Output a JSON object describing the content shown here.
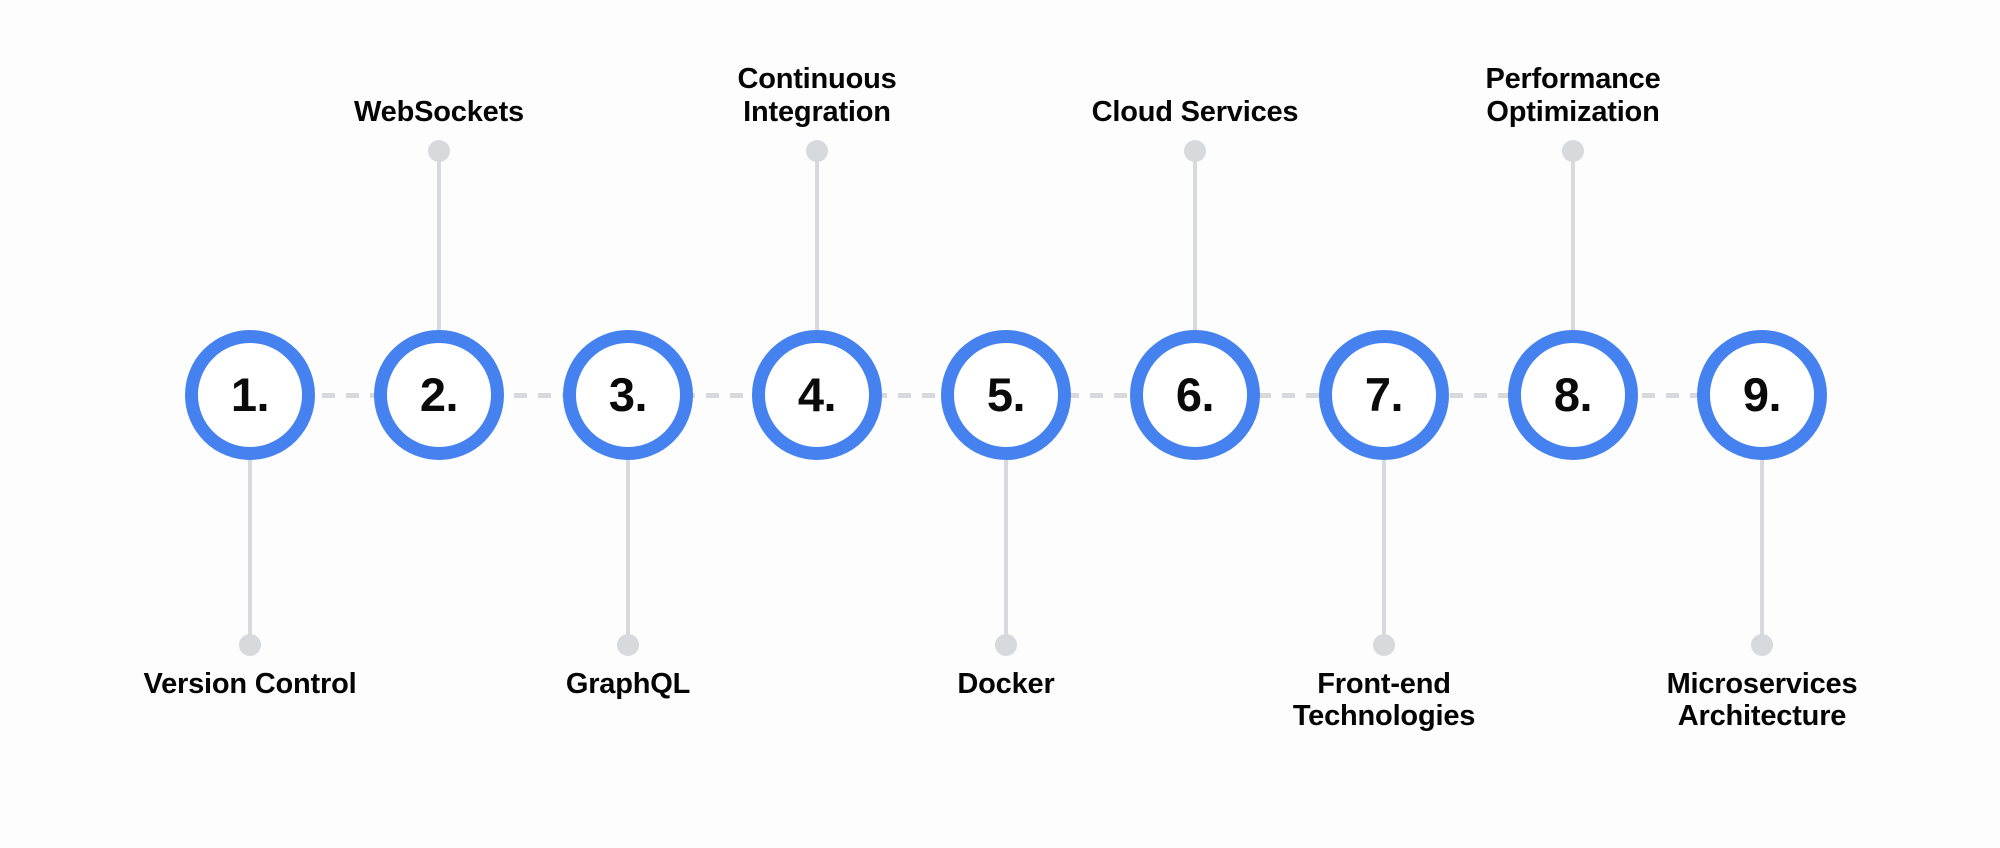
{
  "diagram": {
    "type": "horizontal-numbered-timeline",
    "orientation": "horizontal",
    "step_count": 9,
    "colors": {
      "accent": "#4582f0",
      "connector": "#d7d9dd",
      "text": "#050505",
      "background": "#fdfdfd",
      "circle_fill": "#ffffff"
    },
    "steps": [
      {
        "number": "1.",
        "label": "Version Control",
        "side": "below"
      },
      {
        "number": "2.",
        "label": "WebSockets",
        "side": "above"
      },
      {
        "number": "3.",
        "label": "GraphQL",
        "side": "below"
      },
      {
        "number": "4.",
        "label": "Continuous\nIntegration",
        "side": "above"
      },
      {
        "number": "5.",
        "label": "Docker",
        "side": "below"
      },
      {
        "number": "6.",
        "label": "Cloud Services",
        "side": "above"
      },
      {
        "number": "7.",
        "label": "Front-end\nTechnologies",
        "side": "below"
      },
      {
        "number": "8.",
        "label": "Performance\nOptimization",
        "side": "above"
      },
      {
        "number": "9.",
        "label": "Microservices\nArchitecture",
        "side": "below"
      }
    ]
  }
}
